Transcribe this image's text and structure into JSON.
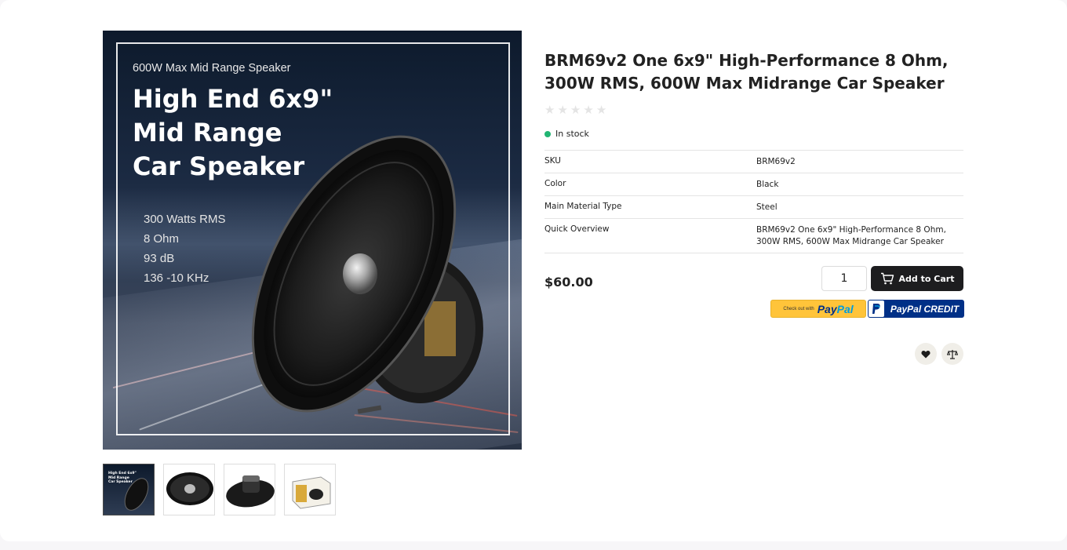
{
  "gallery": {
    "main_image": {
      "subtitle": "600W Max Mid Range Speaker",
      "headline": [
        "High End 6x9\"",
        "Mid Range",
        "Car Speaker"
      ],
      "specs": [
        "300 Watts RMS",
        "8 Ohm",
        "93 dB",
        "136 -10 KHz"
      ]
    },
    "thumbnails": [
      {
        "icon": "ad-image-thumbnail",
        "active": true,
        "text": [
          "High End 6x9\"",
          "Mid Range",
          "Car Speaker"
        ]
      },
      {
        "icon": "speaker-front-thumbnail",
        "active": false
      },
      {
        "icon": "speaker-back-thumbnail",
        "active": false
      },
      {
        "icon": "box-thumbnail",
        "active": false
      }
    ]
  },
  "product": {
    "title": "BRM69v2 One 6x9\" High-Performance 8 Ohm, 300W RMS, 600W Max Midrange Car Speaker",
    "rating": 0,
    "rating_max": 5,
    "stock_status": "In stock",
    "stock_color": "#22b573",
    "specs": [
      {
        "key": "SKU",
        "value": "BRM69v2"
      },
      {
        "key": "Color",
        "value": "Black"
      },
      {
        "key": "Main Material Type",
        "value": "Steel"
      },
      {
        "key": "Quick Overview",
        "value": "BRM69v2 One 6x9\" High-Performance 8 Ohm, 300W RMS, 600W Max Midrange Car Speaker"
      }
    ],
    "price": "$60.00",
    "quantity": "1",
    "add_to_cart_label": "Add to Cart",
    "paypal": {
      "small_label": "Check out with",
      "brand_a": "Pay",
      "brand_b": "Pal"
    },
    "paypal_credit_label": "PayPal CREDIT",
    "wishlist_icon": "heart-icon",
    "compare_icon": "scale-icon"
  },
  "colors": {
    "accent_dark": "#1d1d1f",
    "paypal_yellow": "#ffc43a",
    "paypal_blue": "#003087"
  }
}
